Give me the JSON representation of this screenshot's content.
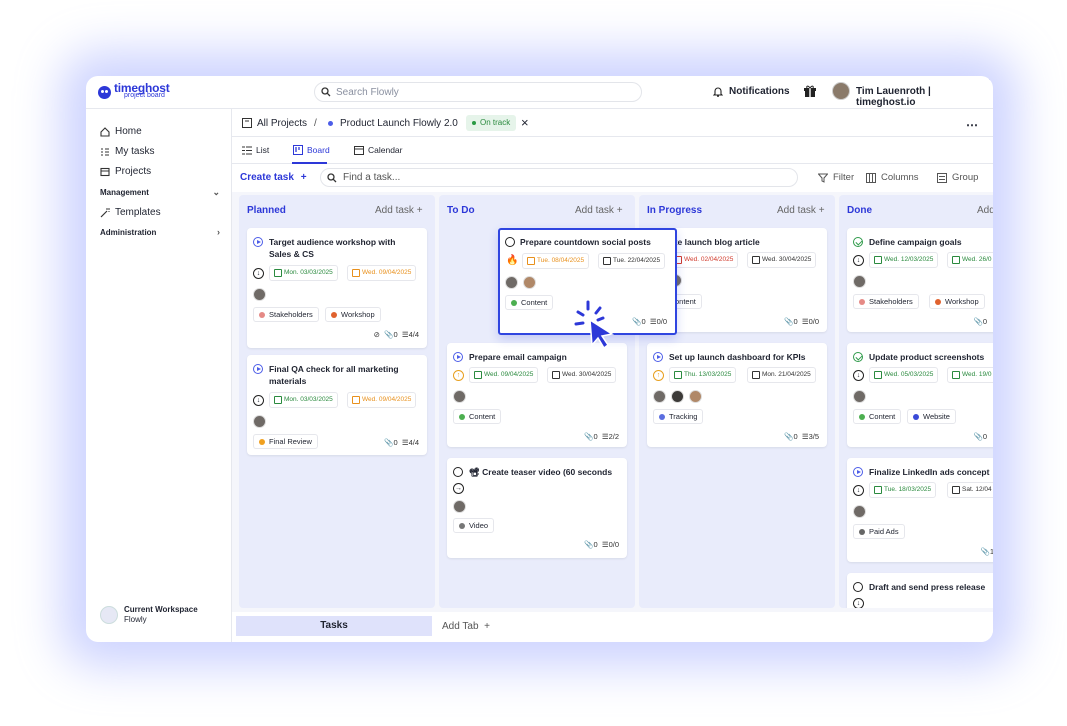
{
  "app": {
    "logo_name": "timeghost",
    "logo_sub": "project board"
  },
  "search": {
    "placeholder": "Search Flowly"
  },
  "topbar": {
    "notifications": "Notifications",
    "user": "Tim Lauenroth | timeghost.io"
  },
  "sidebar": {
    "items": [
      {
        "label": "Home",
        "icon": "home-icon"
      },
      {
        "label": "My tasks",
        "icon": "checklist-icon"
      },
      {
        "label": "Projects",
        "icon": "folder-icon"
      }
    ],
    "management": "Management",
    "templates": "Templates",
    "administration": "Administration",
    "workspace_title": "Current Workspace",
    "workspace_name": "Flowly"
  },
  "breadcrumb": {
    "all": "All Projects",
    "sep": "/",
    "project": "Product Launch Flowly 2.0",
    "status": "On track",
    "close": "×"
  },
  "views": {
    "list": "List",
    "board": "Board",
    "calendar": "Calendar"
  },
  "toolbar": {
    "create": "Create task",
    "find_placeholder": "Find a task...",
    "filter": "Filter",
    "columns": "Columns",
    "group": "Group"
  },
  "columns": [
    {
      "title": "Planned",
      "add": "Add task"
    },
    {
      "title": "To Do",
      "add": "Add task"
    },
    {
      "title": "In Progress",
      "add": "Add task"
    },
    {
      "title": "Done",
      "add": "Add"
    }
  ],
  "cards": {
    "p1": {
      "title": "Target audience workshop with Sales & CS",
      "start": "Mon. 03/03/2025",
      "due": "Wed. 09/04/2025",
      "tags": [
        "Stakeholders",
        "Workshop"
      ],
      "attach": "0",
      "sub": "4/4"
    },
    "p2": {
      "title": "Final QA check for all marketing materials",
      "start": "Mon. 03/03/2025",
      "due": "Wed. 09/04/2025",
      "tags": [
        "Final Review"
      ],
      "attach": "0",
      "sub": "4/4"
    },
    "t0": {
      "title": "Prepare countdown social posts",
      "start": "Tue. 08/04/2025",
      "due": "Tue. 22/04/2025",
      "tags": [
        "Content"
      ],
      "attach": "0",
      "sub": "0/0"
    },
    "t1": {
      "title": "Prepare email campaign",
      "start": "Wed. 09/04/2025",
      "due": "Wed. 30/04/2025",
      "tags": [
        "Content"
      ],
      "attach": "0",
      "sub": "2/2"
    },
    "t2": {
      "title": "📽 Create teaser video (60 seconds",
      "tags": [
        "Video"
      ],
      "attach": "0",
      "sub": "0/0"
    },
    "i1": {
      "title": "rite launch blog article",
      "start": "Wed. 02/04/2025",
      "due": "Wed. 30/04/2025",
      "tags": [
        "ontent"
      ],
      "attach": "0",
      "sub": "0/0"
    },
    "i2": {
      "title": "Set up launch dashboard for KPIs",
      "start": "Thu. 13/03/2025",
      "due": "Mon. 21/04/2025",
      "tags": [
        "Tracking"
      ],
      "attach": "0",
      "sub": "3/5"
    },
    "d1": {
      "title": "Define campaign goals",
      "start": "Wed. 12/03/2025",
      "due": "Wed. 26/0",
      "tags": [
        "Stakeholders",
        "Workshop"
      ],
      "attach": "0"
    },
    "d2": {
      "title": "Update product screenshots",
      "start": "Wed. 05/03/2025",
      "due": "Wed. 19/0",
      "tags": [
        "Content",
        "Website"
      ],
      "attach": "0"
    },
    "d3": {
      "title": "Finalize LinkedIn ads concept",
      "start": "Tue. 18/03/2025",
      "due": "Sat. 12/04",
      "tags": [
        "Paid Ads"
      ],
      "attach": "1"
    },
    "d4": {
      "title": "Draft and send press release"
    }
  },
  "tags_colors": {
    "Stakeholders": "#e58a86",
    "Workshop": "#e0622e",
    "Final Review": "#f0a020",
    "Content": "#4caf50",
    "Video": "#777777",
    "Tracking": "#5b6ee0",
    "Website": "#3a4ad8",
    "Paid Ads": "#666666"
  },
  "bottom": {
    "tab": "Tasks",
    "add_tab": "Add Tab"
  },
  "colors": {
    "accent": "#2d38d8",
    "board_bg": "#e9ecfb"
  }
}
